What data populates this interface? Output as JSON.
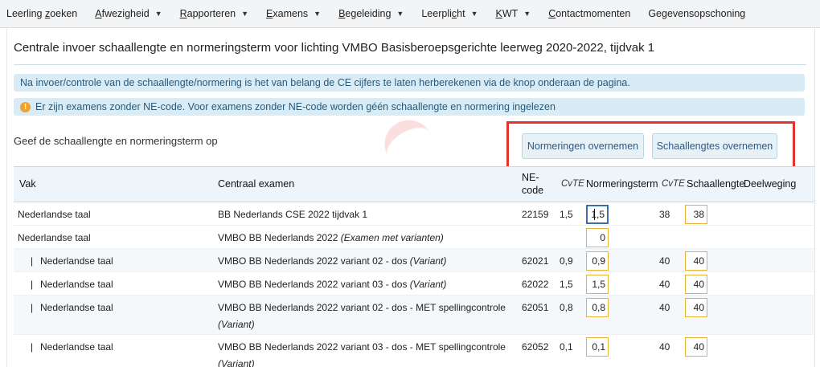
{
  "nav": [
    {
      "name": "nav-leerling-zoeken",
      "pre": "Leerling ",
      "ul": "z",
      "post": "oeken",
      "caret": false
    },
    {
      "name": "nav-afwezigheid",
      "pre": "",
      "ul": "A",
      "post": "fwezigheid",
      "caret": true
    },
    {
      "name": "nav-rapporteren",
      "pre": "",
      "ul": "R",
      "post": "apporteren",
      "caret": true
    },
    {
      "name": "nav-examens",
      "pre": "",
      "ul": "E",
      "post": "xamens",
      "caret": true
    },
    {
      "name": "nav-begeleiding",
      "pre": "",
      "ul": "B",
      "post": "egeleiding",
      "caret": true
    },
    {
      "name": "nav-leerplicht",
      "pre": "Leerpli",
      "ul": "c",
      "post": "ht",
      "caret": true
    },
    {
      "name": "nav-kwt",
      "pre": "",
      "ul": "K",
      "post": "WT",
      "caret": true
    },
    {
      "name": "nav-contactmomenten",
      "pre": "",
      "ul": "C",
      "post": "ontactmomenten",
      "caret": false
    },
    {
      "name": "nav-gegevensopschoning",
      "pre": "Gegevensopschoning",
      "ul": "",
      "post": "",
      "caret": false
    }
  ],
  "page": {
    "title": "Centrale invoer schaallengte en normeringsterm voor lichting VMBO Basisberoepsgerichte leerweg 2020-2022, tijdvak 1",
    "info1": "Na invoer/controle van de schaallengte/normering is het van belang de CE cijfers te laten herberekenen via de knop onderaan de pagina.",
    "info2": "Er zijn examens zonder NE-code. Voor examens zonder NE-code worden géén schaallengte en normering ingelezen",
    "warn_glyph": "!",
    "subhead": "Geef de schaallengte en normeringsterm op",
    "btn_normeringen": "Normeringen overnemen",
    "btn_schaallengtes": "Schaallengtes overnemen"
  },
  "table": {
    "headers": {
      "vak": "Vak",
      "ce": "Centraal examen",
      "ne1": "NE-",
      "ne2": "code",
      "cvte1": "CvTE",
      "norm": "Normeringsterm",
      "cvte2": "CvTE",
      "schaal": "Schaallengte",
      "deel": "Deelweging"
    },
    "rows": [
      {
        "vak": "Nederlandse taal",
        "indent": false,
        "ce": "BB Nederlands CSE 2022 tijdvak 1",
        "ce_i": "",
        "ce2": "",
        "ne": "22159",
        "cvte1": "1,5",
        "norm": "1,5",
        "norm_focus": true,
        "cvte2": "38",
        "schaal": "38",
        "alt": false,
        "h": 28
      },
      {
        "vak": "Nederlandse taal",
        "indent": false,
        "ce": "VMBO BB Nederlands 2022 ",
        "ce_i": "(Examen met varianten)",
        "ce2": "",
        "ne": "",
        "cvte1": "",
        "norm": "0",
        "norm_focus": false,
        "cvte2": "",
        "schaal": "",
        "alt": false,
        "h": 28
      },
      {
        "vak": "Nederlandse taal",
        "indent": true,
        "ce": "VMBO BB Nederlands 2022 variant 02 - dos ",
        "ce_i": "(Variant)",
        "ce2": "",
        "ne": "62021",
        "cvte1": "0,9",
        "norm": "0,9",
        "norm_focus": false,
        "cvte2": "40",
        "schaal": "40",
        "alt": true,
        "h": 28
      },
      {
        "vak": "Nederlandse taal",
        "indent": true,
        "ce": "VMBO BB Nederlands 2022 variant 03 - dos ",
        "ce_i": "(Variant)",
        "ce2": "",
        "ne": "62022",
        "cvte1": "1,5",
        "norm": "1,5",
        "norm_focus": false,
        "cvte2": "40",
        "schaal": "40",
        "alt": false,
        "h": 28
      },
      {
        "vak": "Nederlandse taal",
        "indent": true,
        "ce": "VMBO BB Nederlands 2022 variant 02 - dos - MET spellingcontrole",
        "ce_i": "",
        "ce2": "(Variant)",
        "ne": "62051",
        "cvte1": "0,8",
        "norm": "0,8",
        "norm_focus": false,
        "cvte2": "40",
        "schaal": "40",
        "alt": true,
        "h": 48
      },
      {
        "vak": "Nederlandse taal",
        "indent": true,
        "ce": "VMBO BB Nederlands 2022 variant 03 - dos - MET spellingcontrole",
        "ce_i": "",
        "ce2": "(Variant)",
        "ne": "62052",
        "cvte1": "0,1",
        "norm": "0,1",
        "norm_focus": false,
        "cvte2": "40",
        "schaal": "40",
        "alt": false,
        "h": 48
      }
    ]
  },
  "indent_glyph": "|"
}
